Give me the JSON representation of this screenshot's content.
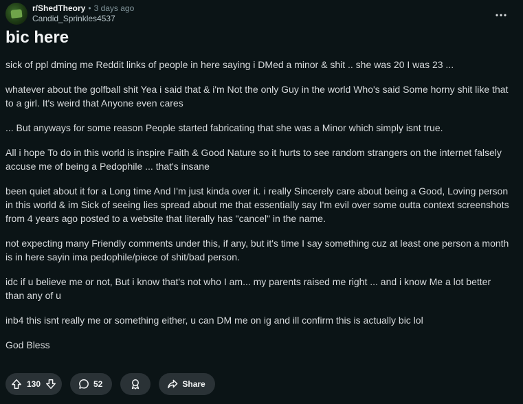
{
  "post": {
    "subreddit": "r/ShedTheory",
    "separator": "•",
    "time_ago": "3 days ago",
    "author": "Candid_Sprinkles4537",
    "title": "bic here",
    "paragraphs": [
      "sick of ppl dming me Reddit links of people in here saying i DMed a minor & shit .. she was 20 I was 23 ...",
      "whatever about the golfball shit Yea i said that & i'm Not the only Guy in the world Who's said Some horny shit like that to a girl. It's weird that Anyone even cares",
      "... But anyways for some reason People started fabricating that she was a Minor which simply isnt true.",
      "All i hope To do in this world is inspire Faith & Good Nature so it hurts to see random strangers on the internet falsely accuse me of being a Pedophile ... that's insane",
      "been quiet about it for a Long time And I'm just kinda over it. i really Sincerely care about being a Good, Loving person in this world & im Sick of seeing lies spread about me that essentially say I'm evil over some outta context screenshots from 4 years ago posted to a website that literally has \"cancel\" in the name.",
      "not expecting many Friendly comments under this, if any, but it's time I say something cuz at least one person a month is in here sayin ima pedophile/piece of shit/bad person.",
      "idc if u believe me or not, But i know that's not who I am... my parents raised me right ... and i know Me a lot better than any of u",
      "inb4 this isnt really me or something either, u can DM me on ig and ill confirm this is actually bic lol",
      "God Bless"
    ]
  },
  "actions": {
    "score": "130",
    "comment_count": "52",
    "share_label": "Share"
  },
  "icons": {
    "upvote": "upvote-arrow-icon",
    "downvote": "downvote-arrow-icon",
    "comment": "comment-bubble-icon",
    "award": "award-icon",
    "share": "share-arrow-icon",
    "more": "more-options-icon"
  },
  "colors": {
    "background": "#0b1416",
    "pill": "#2a3236",
    "title": "#f2f4f5",
    "text": "#d7dadc",
    "muted": "#82959b"
  }
}
